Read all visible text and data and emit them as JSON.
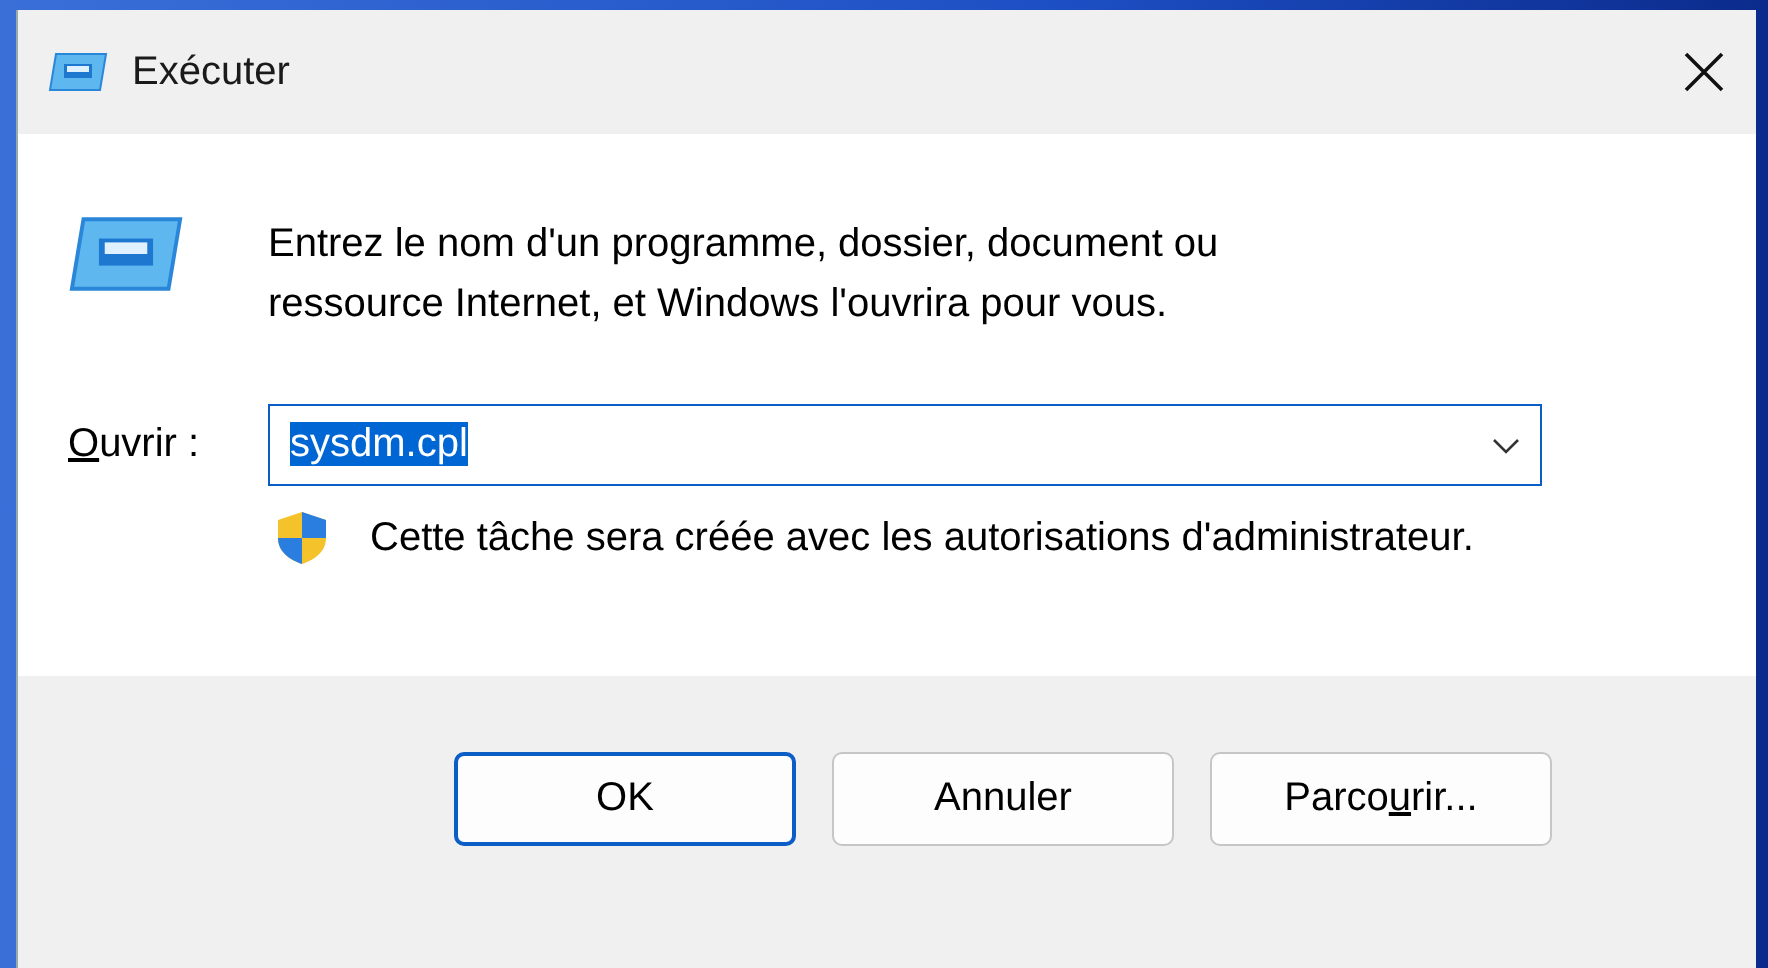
{
  "window": {
    "title": "Exécuter"
  },
  "message": "Entrez le nom d'un programme, dossier, document ou ressource Internet, et Windows l'ouvrira pour vous.",
  "open_field": {
    "label": {
      "key": "O",
      "after": "uvrir :"
    },
    "value": "sysdm.cpl",
    "text_selected": true
  },
  "admin_note": "Cette tâche sera créée avec les autorisations d'administrateur.",
  "buttons": [
    {
      "label": {
        "before": "OK"
      },
      "default": true
    },
    {
      "label": {
        "before": "Annuler"
      },
      "default": false
    },
    {
      "label": {
        "before": "Parco",
        "key": "u",
        "after": "rir..."
      },
      "default": false
    }
  ]
}
